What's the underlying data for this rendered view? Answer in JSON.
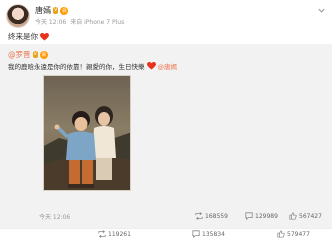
{
  "post": {
    "author": "唐嫣",
    "vip": "V",
    "member": "会",
    "time": "今天 12:06",
    "source": "来自 iPhone 7 Plus",
    "text": "终来是你"
  },
  "repost": {
    "author": "@罗晋",
    "text_a": "我的鹿晗永遠是你的依靠！親愛的你，生日快樂",
    "mention": "@唐嫣",
    "timestamp": "今天 12:06",
    "stats": {
      "reposts": "168559",
      "comments": "129989",
      "likes": "567427"
    }
  },
  "bottom": {
    "reposts": "119261",
    "comments": "135834",
    "likes": "579477"
  },
  "colors": {
    "accent": "#eb7350",
    "heart": "#e8321b",
    "repost_bg": "#f2f2f2"
  }
}
